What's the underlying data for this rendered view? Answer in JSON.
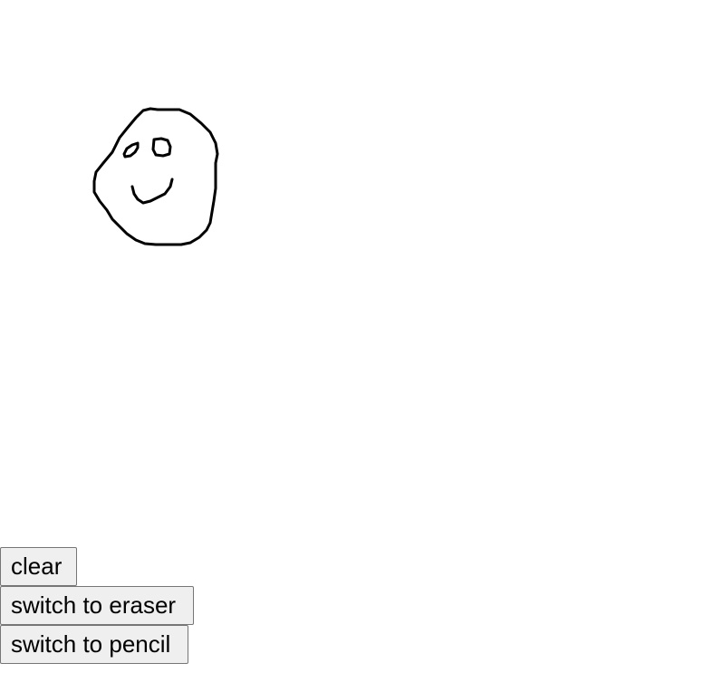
{
  "canvas": {
    "background": "#ffffff",
    "stroke_color": "#000000"
  },
  "toolbar": {
    "clear_label": "clear",
    "eraser_label": "switch to eraser",
    "pencil_label": "switch to pencil"
  }
}
